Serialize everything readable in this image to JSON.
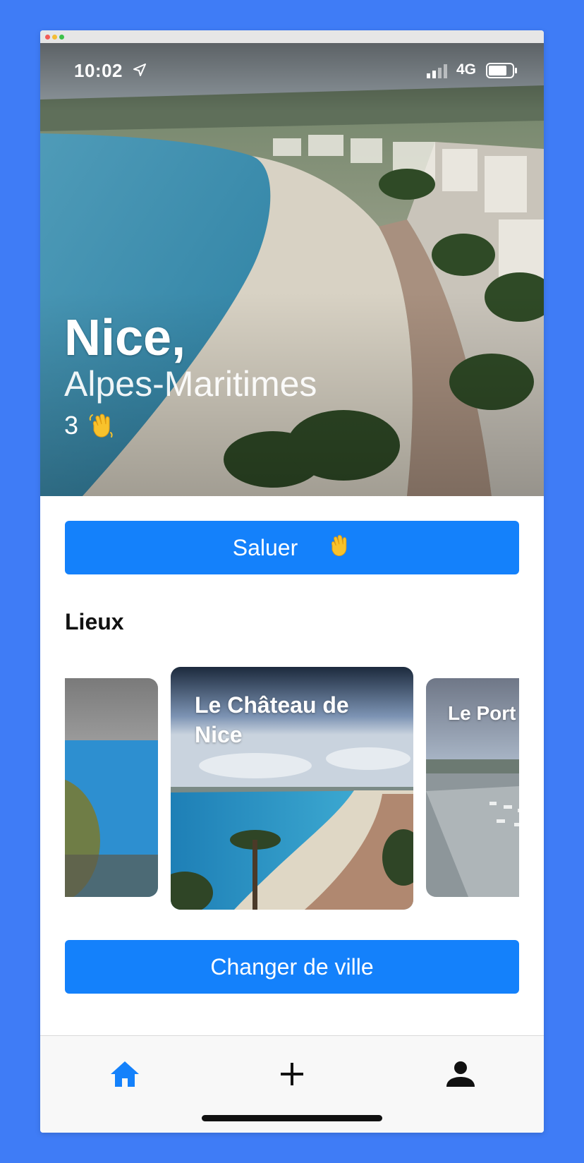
{
  "status_bar": {
    "time": "10:02",
    "network": "4G"
  },
  "hero": {
    "city": "Nice,",
    "region": "Alpes-Maritimes",
    "wave_count": "3"
  },
  "actions": {
    "greet_label": "Saluer",
    "change_city_label": "Changer de ville"
  },
  "places": {
    "title": "Lieux",
    "cards": [
      {
        "label": ""
      },
      {
        "label": "Le Château de Nice"
      },
      {
        "label": "Le Port"
      }
    ]
  },
  "nav": {
    "items": [
      {
        "icon": "home-icon",
        "active": true
      },
      {
        "icon": "plus-icon",
        "active": false
      },
      {
        "icon": "person-icon",
        "active": false
      }
    ]
  },
  "colors": {
    "background": "#3f7cf6",
    "accent": "#1481fb",
    "text": "#111111"
  }
}
